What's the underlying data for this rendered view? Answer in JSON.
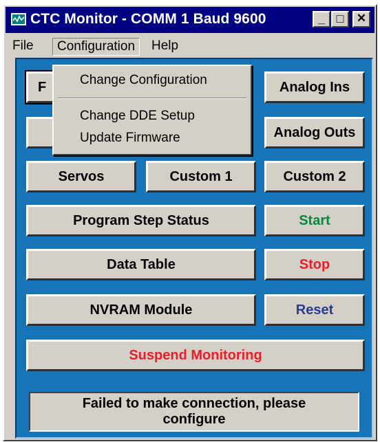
{
  "window": {
    "title": "CTC Monitor - COMM 1 Baud 9600",
    "icon": "monitor-app-icon",
    "controls": {
      "minimize": "_",
      "maximize": "□",
      "close": "✕"
    }
  },
  "menubar": {
    "items": [
      "File",
      "Configuration",
      "Help"
    ],
    "active": "Configuration"
  },
  "dropdown": {
    "items": [
      "Change Configuration",
      "Change DDE Setup",
      "Update Firmware"
    ]
  },
  "buttons": {
    "hidden_left_1": "F",
    "analog_ins": "Analog Ins",
    "analog_outs": "Analog Outs",
    "servos": "Servos",
    "custom1": "Custom 1",
    "custom2": "Custom 2",
    "program_step_status": "Program Step Status",
    "start": "Start",
    "data_table": "Data Table",
    "stop": "Stop",
    "nvram_module": "NVRAM Module",
    "reset": "Reset",
    "suspend_monitoring": "Suspend Monitoring"
  },
  "status_text": "Failed to make connection, please configure",
  "colors": {
    "titlebar": "#000080",
    "client_bg": "#1874b8",
    "start": "#008a3c",
    "stop": "#e81e2a",
    "reset": "#2a3a9a",
    "suspend": "#e81e2a"
  }
}
